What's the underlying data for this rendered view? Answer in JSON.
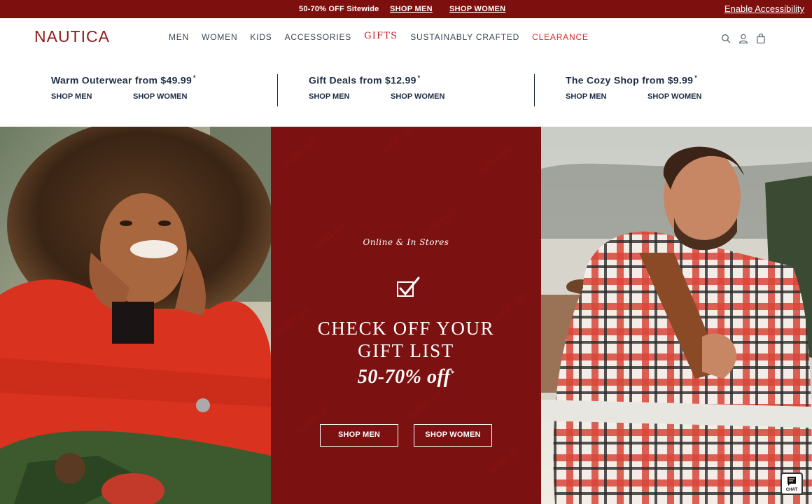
{
  "promo_bar": {
    "text": "50-70% OFF Sitewide",
    "shop_men": "SHOP MEN",
    "shop_women": "SHOP WOMEN",
    "accessibility": "Enable Accessibility"
  },
  "header": {
    "logo": "NAUTICA",
    "nav": [
      {
        "label": "MEN"
      },
      {
        "label": "WOMEN"
      },
      {
        "label": "KIDS"
      },
      {
        "label": "ACCESSORIES"
      },
      {
        "label": "GIFTS"
      },
      {
        "label": "SUSTAINABLY CRAFTED"
      },
      {
        "label": "CLEARANCE"
      }
    ],
    "icons": [
      "search-icon",
      "account-icon",
      "cart-icon"
    ]
  },
  "deals": [
    {
      "title": "Warm Outerwear from $49.99",
      "asterisk": "*",
      "men": "SHOP MEN",
      "women": "SHOP WOMEN"
    },
    {
      "title": "Gift Deals from $12.99",
      "asterisk": "*",
      "men": "SHOP MEN",
      "women": "SHOP WOMEN"
    },
    {
      "title": "The Cozy Shop from $9.99",
      "asterisk": "*",
      "men": "SHOP MEN",
      "women": "SHOP WOMEN"
    }
  ],
  "hero": {
    "subtitle": "Online & In Stores",
    "headline_line1": "CHECK OFF YOUR",
    "headline_line2": "GIFT LIST",
    "discount": "50-70% off",
    "discount_mark": "*",
    "shop_men": "SHOP MEN",
    "shop_women": "SHOP WOMEN",
    "background": "#7b1110"
  },
  "chat": {
    "label": "CHAT"
  },
  "colors": {
    "brand_red": "#7d100f",
    "navy": "#1b2a41",
    "clearance_red": "#d32f2f"
  }
}
